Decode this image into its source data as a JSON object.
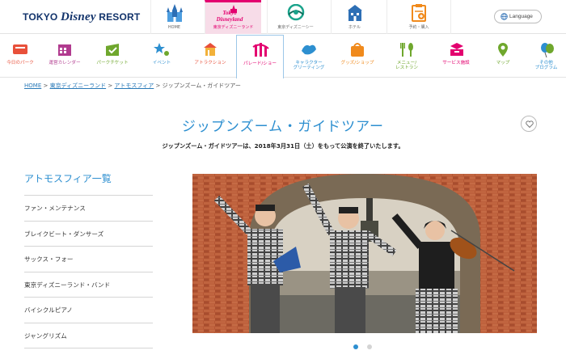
{
  "header": {
    "logo_left": "TOKYO ",
    "logo_mid": "Disney",
    "logo_right": " RESORT",
    "top_nav": [
      {
        "label": "HOME",
        "icon": "castle-icon"
      },
      {
        "label": "東京ディズニーランド",
        "line1": "Tokyo",
        "line2": "Disneyland",
        "icon": "tokyo-disneyland-logo"
      },
      {
        "label": "東京ディズニーシー",
        "icon": "disneysea-logo"
      },
      {
        "label": "ホテル",
        "icon": "hotel-icon"
      },
      {
        "label": "予約・購入",
        "icon": "reservation-icon"
      }
    ],
    "language": "Language"
  },
  "main_nav": [
    {
      "label": "今日のパーク",
      "color": "#e8503a"
    },
    {
      "label": "運営カレンダー",
      "color": "#b13b8f"
    },
    {
      "label": "パークチケット",
      "color": "#6fa72d"
    },
    {
      "label": "イベント",
      "color": "#2d8fd0"
    },
    {
      "label": "アトラクション",
      "color": "#e8503a"
    },
    {
      "label": "パレード/ショー",
      "color": "#e3006f"
    },
    {
      "label": "キャラクター\nグリーティング",
      "color": "#2d8fd0"
    },
    {
      "label": "グッズ/ショップ",
      "color": "#f08a1c"
    },
    {
      "label": "メニュー/\nレストラン",
      "color": "#6fa72d"
    },
    {
      "label": "サービス施設",
      "color": "#e3006f"
    },
    {
      "label": "マップ",
      "color": "#6fa72d"
    },
    {
      "label": "その他\nプログラム",
      "color": "#2d8fd0"
    }
  ],
  "breadcrumb": {
    "home": "HOME",
    "tdl": "東京ディズニーランド",
    "atm": "アトモスフィア",
    "current": "ジップンズーム・ガイドツアー",
    "sep": " > "
  },
  "page": {
    "title": "ジップンズーム・ガイドツアー",
    "notice": "ジップンズーム・ガイドツアーは、2018年3月31日（土）をもって公演を終了いたします。"
  },
  "sidebar": {
    "heading": "アトモスフィア一覧",
    "items": [
      "ファン・メンテナンス",
      "ブレイクビート・ダンサーズ",
      "サックス・フォー",
      "東京ディズニーランド・バンド",
      "バイシクルピアノ",
      "ジャングリズム"
    ]
  },
  "carousel": {
    "slides": 2,
    "active": 1
  },
  "colors": {
    "accent": "#2d8fd0",
    "pink": "#e3006f",
    "brick": "#b9582f"
  }
}
